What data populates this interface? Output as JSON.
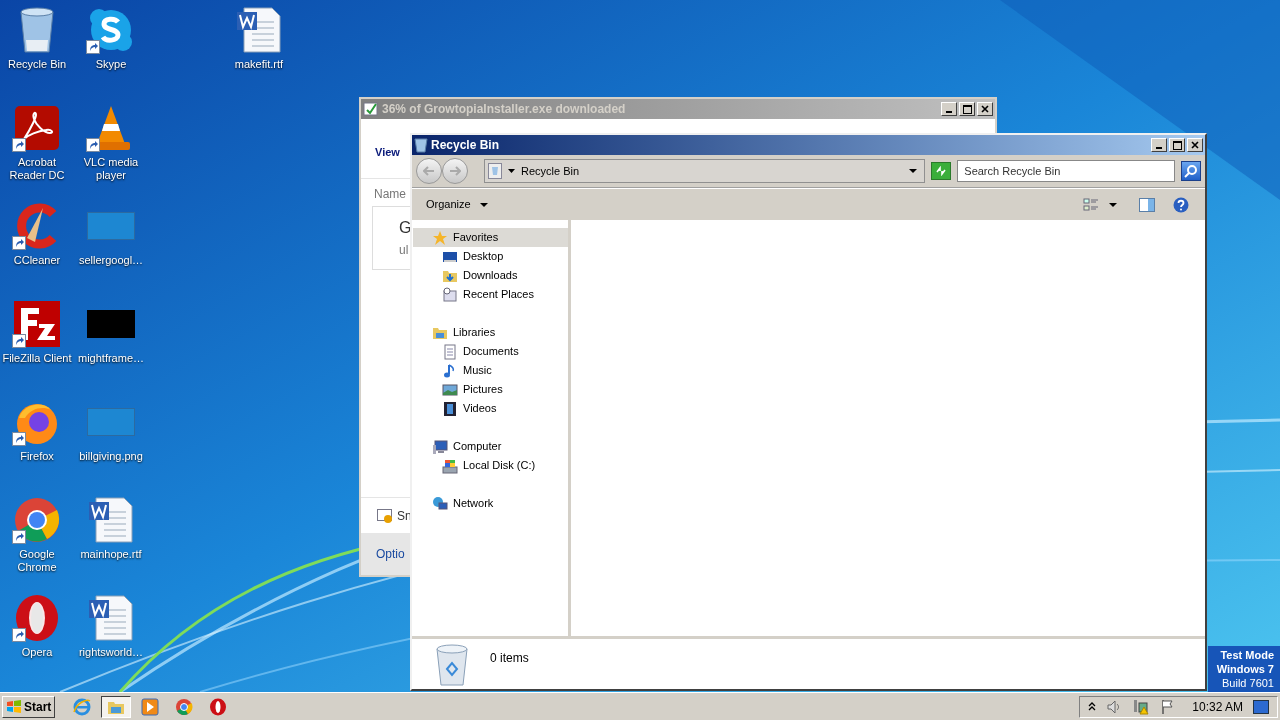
{
  "desktop": {
    "columns": [
      [
        {
          "label": "Recycle Bin",
          "kind": "recycle-bin",
          "shortcut": false
        },
        {
          "label": "Acrobat Reader DC",
          "kind": "acrobat",
          "shortcut": true
        },
        {
          "label": "CCleaner",
          "kind": "ccleaner",
          "shortcut": true
        },
        {
          "label": "FileZilla Client",
          "kind": "filezilla",
          "shortcut": true
        },
        {
          "label": "Firefox",
          "kind": "firefox",
          "shortcut": true
        },
        {
          "label": "Google Chrome",
          "kind": "chrome",
          "shortcut": true
        },
        {
          "label": "Opera",
          "kind": "opera",
          "shortcut": true
        }
      ],
      [
        {
          "label": "Skype",
          "kind": "skype",
          "shortcut": true
        },
        {
          "label": "VLC media player",
          "kind": "vlc",
          "shortcut": true
        },
        {
          "label": "sellergoogl…",
          "kind": "blank-image",
          "shortcut": false
        },
        {
          "label": "mightframe…",
          "kind": "dark-image",
          "shortcut": false
        },
        {
          "label": "billgiving.png",
          "kind": "blank-image",
          "shortcut": false
        },
        {
          "label": "mainhope.rtf",
          "kind": "word",
          "shortcut": false
        },
        {
          "label": "rightsworld…",
          "kind": "word",
          "shortcut": false
        }
      ],
      [
        {
          "label": "makefit.rtf",
          "kind": "word",
          "shortcut": false
        }
      ]
    ]
  },
  "download_window": {
    "title": "36% of GrowtopiaInstaller.exe downloaded",
    "active": false,
    "link": "View",
    "column_header": "Name",
    "item_lines": [
      "G",
      "ul"
    ],
    "warning": "Sn",
    "footer_link": "Optio"
  },
  "explorer": {
    "title": "Recycle Bin",
    "active": true,
    "address": "Recycle Bin",
    "search_placeholder": "Search Recycle Bin",
    "organize": "Organize",
    "nav": [
      {
        "label": "Favorites",
        "kind": "star",
        "selected": true,
        "children": [
          {
            "label": "Desktop",
            "kind": "desktop",
            "selected": false
          },
          {
            "label": "Downloads",
            "kind": "downloads",
            "selected": false
          },
          {
            "label": "Recent Places",
            "kind": "recent",
            "selected": false
          }
        ]
      },
      {
        "label": "Libraries",
        "kind": "libraries",
        "selected": false,
        "children": [
          {
            "label": "Documents",
            "kind": "documents",
            "selected": false
          },
          {
            "label": "Music",
            "kind": "music",
            "selected": false
          },
          {
            "label": "Pictures",
            "kind": "pictures",
            "selected": false
          },
          {
            "label": "Videos",
            "kind": "videos",
            "selected": false
          }
        ]
      },
      {
        "label": "Computer",
        "kind": "computer",
        "selected": false,
        "children": [
          {
            "label": "Local Disk (C:)",
            "kind": "disk",
            "selected": false
          }
        ]
      },
      {
        "label": "Network",
        "kind": "network",
        "selected": false
      }
    ],
    "status": "0 items"
  },
  "taskbar": {
    "start": "Start",
    "pinned": [
      {
        "kind": "ie",
        "selected": false
      },
      {
        "kind": "explorer",
        "selected": true
      },
      {
        "kind": "media",
        "selected": false
      },
      {
        "kind": "chrome",
        "selected": false
      },
      {
        "kind": "opera",
        "selected": false
      }
    ],
    "clock": "10:32 AM"
  },
  "test_mode": [
    "Test Mode",
    "Windows 7",
    "Build 7601"
  ]
}
